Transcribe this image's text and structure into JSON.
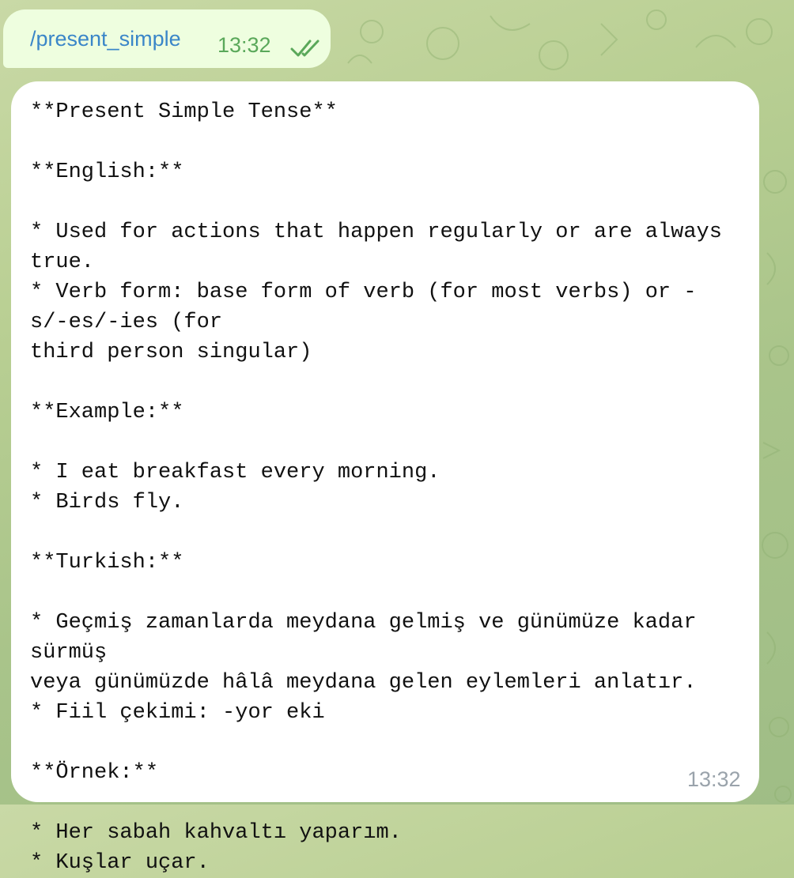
{
  "chat": {
    "outgoing": {
      "command": "/present_simple",
      "time": "13:32",
      "status_icon": "double-check-icon",
      "status_color": "#5aa85a"
    },
    "incoming": {
      "lines": [
        "**Present Simple Tense**",
        "",
        "**English:**",
        "",
        "* Used for actions that happen regularly or are always true.",
        "* Verb form: base form of verb (for most verbs) or -s/-es/-ies (for",
        "third person singular)",
        "",
        "**Example:**",
        "",
        "* I eat breakfast every morning.",
        "* Birds fly.",
        "",
        "**Turkish:**",
        "",
        "* Geçmiş zamanlarda meydana gelmiş ve günümüze kadar sürmüş",
        "veya günümüzde hâlâ meydana gelen eylemleri anlatır.",
        "* Fiil çekimi: -yor eki",
        "",
        "**Örnek:**",
        "",
        "* Her sabah kahvaltı yaparım.",
        "* Kuşlar uçar."
      ],
      "time": "13:32"
    }
  },
  "colors": {
    "background": "#b9cf93",
    "outgoing_bubble": "#eefedf",
    "incoming_bubble": "#ffffff",
    "command_link": "#3a86c8"
  }
}
